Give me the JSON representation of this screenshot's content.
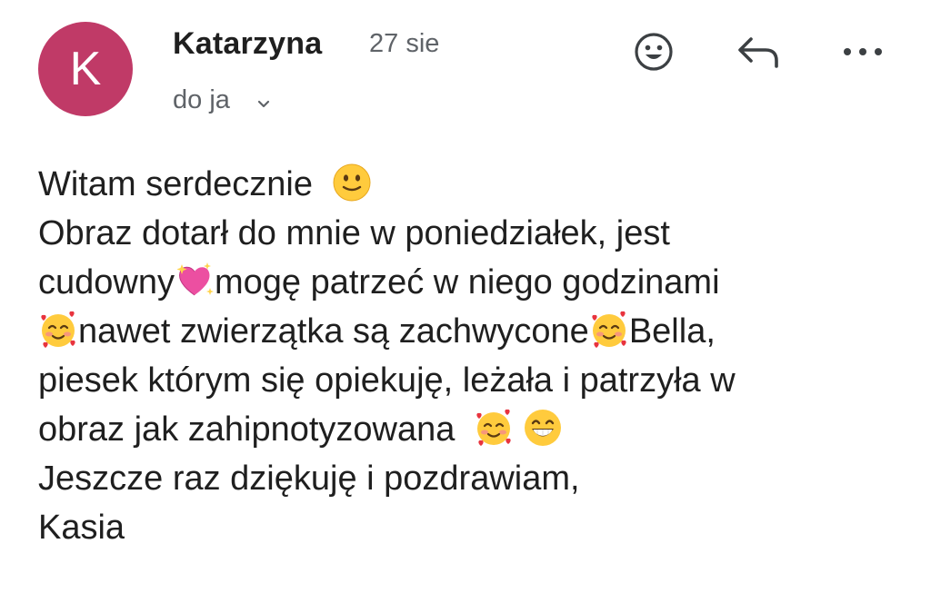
{
  "sender": {
    "avatar_letter": "K",
    "avatar_color": "#c03a67",
    "name": "Katarzyna",
    "date": "27 sie",
    "recipient": "do ja"
  },
  "actions": {
    "emoji": "smiley-reaction-icon",
    "reply": "reply-arrow-icon",
    "more": "more-horizontal-icon"
  },
  "message": {
    "line1": "Witam serdecznie",
    "line2": "Obraz dotarł do mnie w poniedziałek, jest",
    "line3a": "cudowny",
    "line3b": "mogę patrzeć w niego godzinami",
    "line4a": "nawet zwierzątka są zachwycone",
    "line4b": "Bella,",
    "line5": "piesek którym się opiekuję, leżała i patrzyła w",
    "line6": "obraz jak zahipnotyzowana",
    "line7": "Jeszcze raz dziękuję i pozdrawiam,",
    "line8": "Kasia",
    "emojis": [
      "slightly-smiling-face",
      "sparkling-heart",
      "smiling-face-with-hearts",
      "smiling-face-with-hearts",
      "smiling-face-with-hearts",
      "grinning-face"
    ]
  }
}
